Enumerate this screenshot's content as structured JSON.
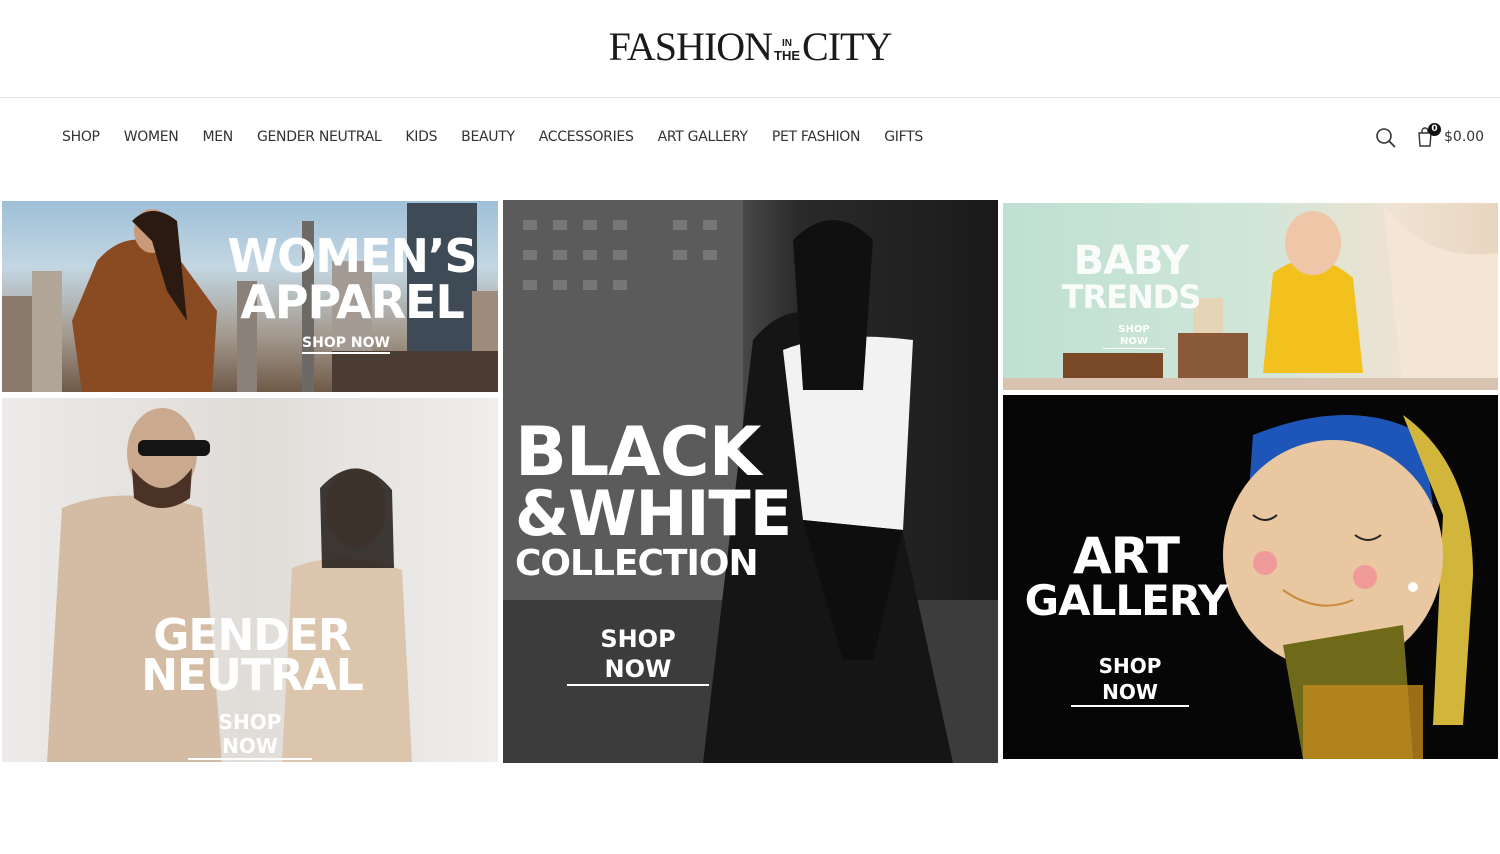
{
  "logo": {
    "left": "FASHION",
    "mid_top": "IN",
    "mid_bottom": "THE",
    "right": "CITY"
  },
  "nav": {
    "items": [
      {
        "label": "SHOP"
      },
      {
        "label": "WOMEN"
      },
      {
        "label": "MEN"
      },
      {
        "label": "GENDER NEUTRAL"
      },
      {
        "label": "KIDS"
      },
      {
        "label": "BEAUTY"
      },
      {
        "label": "ACCESSORIES"
      },
      {
        "label": "ART GALLERY"
      },
      {
        "label": "PET FASHION"
      },
      {
        "label": "GIFTS"
      }
    ]
  },
  "cart": {
    "count": "0",
    "total": "$0.00"
  },
  "tiles": {
    "women": {
      "line1": "WOMEN’S",
      "line2": "APPAREL",
      "cta": "SHOP NOW"
    },
    "bw": {
      "line1": "BLACK",
      "line2": "&WHITE",
      "line3": "COLLECTION",
      "cta": "SHOP NOW"
    },
    "baby": {
      "line1": "BABY",
      "line2": "TRENDS",
      "cta": "SHOP NOW"
    },
    "gender": {
      "line1": "GENDER",
      "line2": "NEUTRAL",
      "cta": "SHOP NOW"
    },
    "art": {
      "line1": "ART",
      "line2": "GALLERY",
      "cta": "SHOP NOW"
    }
  },
  "icons": {
    "search": "search-icon",
    "cart": "cart-icon"
  },
  "colors": {
    "text": "#333333",
    "badge": "#111111"
  }
}
